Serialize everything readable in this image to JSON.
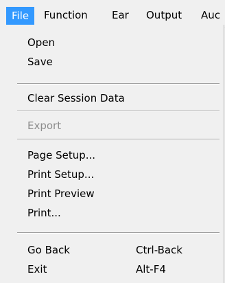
{
  "menubar": {
    "items": [
      {
        "label": "File",
        "active": true
      },
      {
        "label": "Function"
      },
      {
        "label": "Ear"
      },
      {
        "label": "Output"
      },
      {
        "label": "Auc"
      }
    ]
  },
  "file_menu": {
    "open": "Open",
    "save": "Save",
    "clear_session_data": "Clear Session Data",
    "export": "Export",
    "page_setup": "Page Setup...",
    "print_setup": "Print Setup...",
    "print_preview": "Print Preview",
    "print": "Print...",
    "go_back": "Go Back",
    "go_back_shortcut": "Ctrl-Back",
    "exit": "Exit",
    "exit_shortcut": "Alt-F4"
  },
  "colors": {
    "highlight": "#3399ff",
    "menu_background": "#f0f0f0",
    "disabled_text": "#8d8d8d"
  }
}
